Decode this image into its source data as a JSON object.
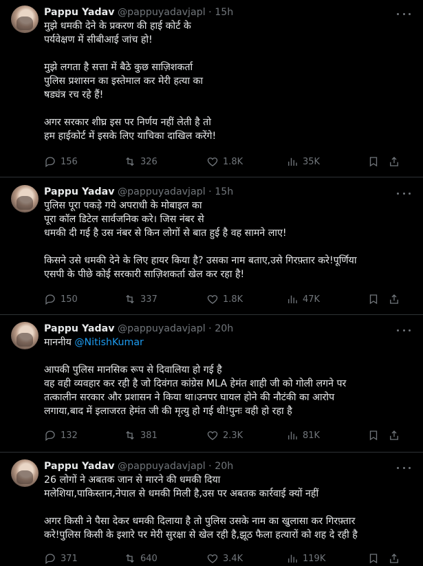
{
  "tweets": [
    {
      "name": "Pappu Yadav",
      "handle": "@pappuyadavjapl",
      "time": "15h",
      "lines": [
        "मुझे धमकी देने के प्रकरण की हाई कोर्ट के",
        "पर्यवेक्षण में सीबीआई जांच हो!",
        "",
        "मुझे लगता है सत्ता में बैठे कुछ साज़िशकर्ता",
        "पुलिस प्रशासन का इस्तेमाल कर मेरी हत्या का",
        "षड्यंत्र रच रहे हैं!",
        "",
        "अगर सरकार शीघ्र इस पर निर्णय नहीं लेती है तो",
        "हम हाईकोर्ट में इसके लिए याचिका दाखिल करेंगे!"
      ],
      "replies": "156",
      "reposts": "326",
      "likes": "1.8K",
      "views": "35K"
    },
    {
      "name": "Pappu Yadav",
      "handle": "@pappuyadavjapl",
      "time": "15h",
      "lines": [
        "पुलिस पूरा पकड़े गये अपराधी के मोबाइल का",
        "पूरा कॉल डिटेल सार्वजनिक करे। जिस नंबर से",
        "धमकी दी गई है उस नंबर से किन लोगों से बात हुई है वह सामने लाए!",
        "",
        "किसने उसे धमकी देने के लिए हायर किया है? उसका नाम बताए,उसे गिरफ़्तार करे!पूर्णिया",
        "एसपी के पीछे कोई सरकारी साज़िशकर्ता खेल कर रहा है!"
      ],
      "replies": "150",
      "reposts": "337",
      "likes": "1.8K",
      "views": "47K"
    },
    {
      "name": "Pappu Yadav",
      "handle": "@pappuyadavjapl",
      "time": "20h",
      "first_line_prefix": "माननीय ",
      "mention": "@NitishKumar",
      "lines": [
        "",
        "आपकी पुलिस मानसिक रूप से दिवालिया हो गई है",
        "वह वही व्यवहार कर रही है जो दिवंगत कांग्रेस MLA हेमंत शाही जी को गोली लगने पर",
        "तत्कालीन सरकार और प्रशासन ने किया था।उनपर घायल होने की नौटंकी का आरोप",
        "लगाया,बाद में इलाजरत हेमंत जी की मृत्यु हो गई थी!पुनः वही हो रहा है"
      ],
      "replies": "132",
      "reposts": "381",
      "likes": "2.3K",
      "views": "81K"
    },
    {
      "name": "Pappu Yadav",
      "handle": "@pappuyadavjapl",
      "time": "20h",
      "lines": [
        "26 लोगों ने अबतक जान से मारने की धमकी दिया",
        "मलेशिया,पाकिस्तान,नेपाल से धमकी मिली है,उस पर अबतक कार्रवाई क्यों नहीं",
        "",
        "अगर किसी ने पैसा देकर धमकी दिलाया है तो पुलिस उसके नाम का खुलासा कर गिरफ़्तार",
        "करे!पुलिस किसी के इशारे पर मेरी सुरक्षा से खेल रही है,झूठ फैला हत्यारों को शह दे रही है"
      ],
      "replies": "371",
      "reposts": "640",
      "likes": "3.4K",
      "views": "119K"
    }
  ],
  "icons": [
    "reply-icon",
    "repost-icon",
    "like-icon",
    "views-icon",
    "bookmark-icon",
    "share-icon",
    "more-icon"
  ]
}
